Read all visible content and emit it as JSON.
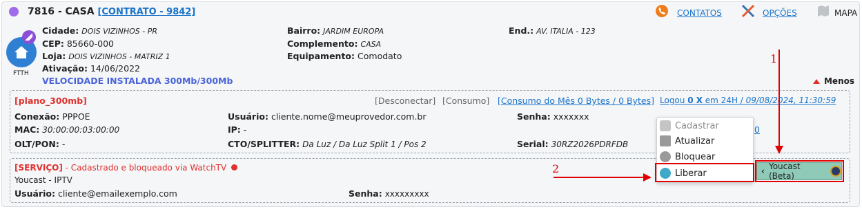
{
  "header": {
    "code": "7816",
    "sep": "-",
    "name": "CASA",
    "contract_link": "[CONTRATO - 9842]",
    "contacts_label": "CONTATOS",
    "options_label": "OPÇÕES",
    "map_label": "MAPA",
    "status_color": "#a06bea"
  },
  "service_icon_label": "FTTH",
  "client": {
    "cidade_label": "Cidade:",
    "cidade": "DOIS VIZINHOS - PR",
    "cep_label": "CEP:",
    "cep": "85660-000",
    "loja_label": "Loja:",
    "loja": "DOIS VIZINHOS - MATRIZ 1",
    "ativacao_label": "Ativação:",
    "ativacao": "14/06/2022",
    "velocidade": "VELOCIDADE INSTALADA 300Mb/300Mb",
    "bairro_label": "Bairro:",
    "bairro": "JARDIM EUROPA",
    "complemento_label": "Complemento:",
    "complemento": "CASA",
    "equipamento_label": "Equipamento:",
    "equipamento": "Comodato",
    "end_label": "End.:",
    "end": "AV. ITALIA - 123"
  },
  "menos_label": "Menos",
  "plan": {
    "name": "[plano_300mb]",
    "desconectar": "[Desconectar]",
    "consumo": "[Consumo]",
    "consumo_mes": "[Consumo do Mês 0 Bytes / 0 Bytes]",
    "logou_prefix": "Logou ",
    "logou_count": "0 X",
    "logou_suffix": " em 24H / ",
    "logou_date": "09/08/2024, 11:30:59",
    "conexao_label": "Conexão:",
    "conexao": "PPPOE",
    "usuario_label": "Usuário:",
    "usuario": "cliente.nome@meuprovedor.com.br",
    "senha_label": "Senha:",
    "senha": "xxxxxxx",
    "mac_label": "MAC:",
    "mac": "30:00:00:03:00:00",
    "ip_label": "IP:",
    "ip": "-",
    "oltpon_label": "OLT/PON:",
    "oltpon": "-",
    "cto_label": "CTO/SPLITTER:",
    "cto": "Da Luz / Da Luz Split 1 / Pos 2",
    "serial_label": "Serial:",
    "serial": "30RZ2026PDRFDB",
    "partial_link": "0"
  },
  "service": {
    "tag": "[SERVIÇO]",
    "status": " - Cadastrado e bloqueado via WatchTV",
    "product": "Youcast - IPTV",
    "usuario_label": "Usuário:",
    "usuario": "cliente@emailexemplo.com",
    "senha_label": "Senha:",
    "senha": "xxxxxxxxx",
    "status_color": "#e0312e"
  },
  "dropdown": {
    "items": [
      {
        "label": "Cadastrar",
        "icon": "cadastrar-icon",
        "enabled": false
      },
      {
        "label": "Atualizar",
        "icon": "edit-icon",
        "enabled": true
      },
      {
        "label": "Bloquear",
        "icon": "lock-icon",
        "enabled": true
      },
      {
        "label": "Liberar",
        "icon": "unlock-icon",
        "enabled": true
      }
    ]
  },
  "youcast_button": "Youcast (Beta)",
  "annotations": {
    "one": "1",
    "two": "2"
  }
}
